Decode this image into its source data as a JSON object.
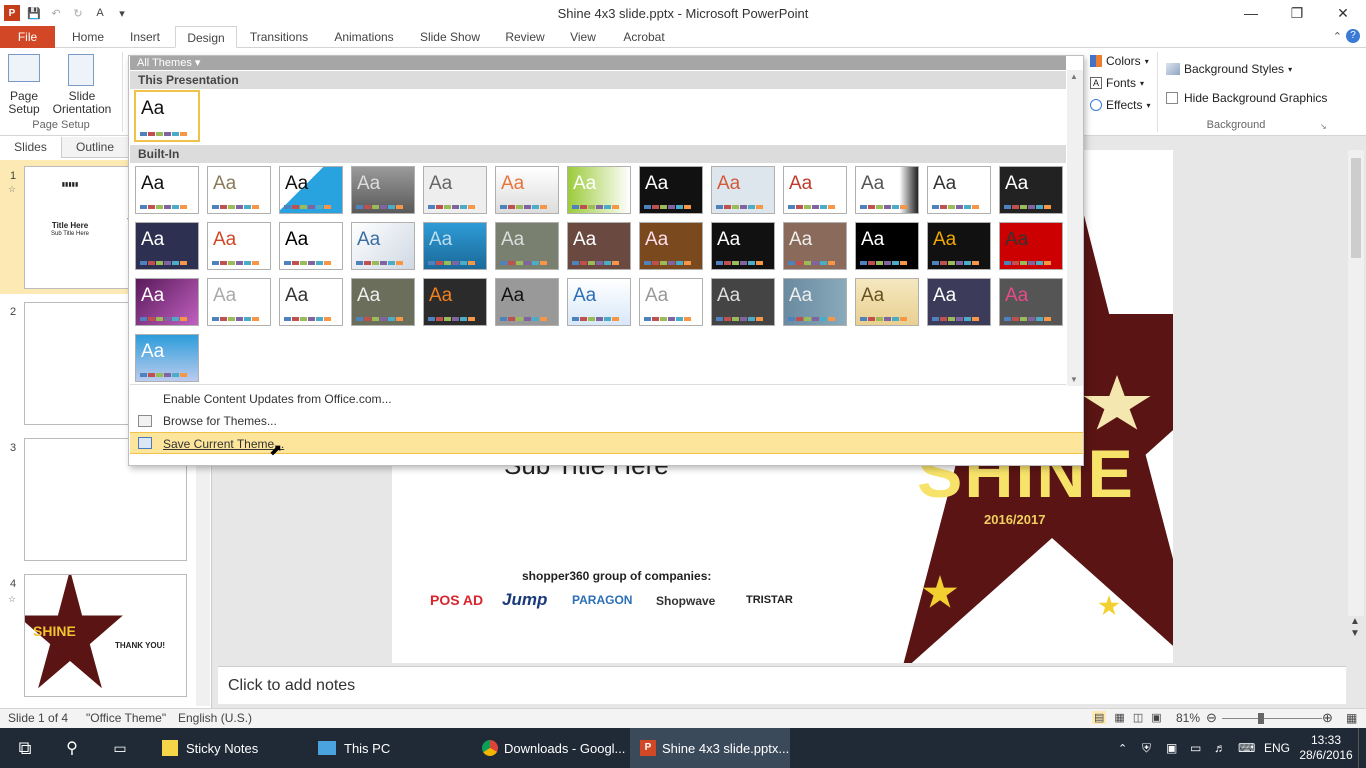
{
  "window": {
    "title": "Shine 4x3 slide.pptx - Microsoft PowerPoint"
  },
  "ribbon_tabs": [
    "File",
    "Home",
    "Insert",
    "Design",
    "Transitions",
    "Animations",
    "Slide Show",
    "Review",
    "View",
    "Acrobat"
  ],
  "ribbon": {
    "page_setup": {
      "page_setup_label": "Page\nSetup",
      "page_setup_l1": "Page",
      "page_setup_l2": "Setup",
      "orientation_l1": "Slide",
      "orientation_l2": "Orientation",
      "group_label": "Page Setup"
    },
    "theme_options": {
      "colors": "Colors",
      "fonts": "Fonts",
      "effects": "Effects"
    },
    "background": {
      "styles": "Background Styles",
      "hide_graphics": "Hide Background Graphics",
      "group_label": "Background"
    }
  },
  "gallery": {
    "filter_label": "All Themes",
    "section_this": "This Presentation",
    "section_builtin": "Built-In",
    "sample_text": "Aa",
    "menu": {
      "enable_updates": "Enable Content Updates from Office.com...",
      "browse": "Browse for Themes...",
      "save_current": "Save Current Theme..."
    }
  },
  "pane": {
    "tab_slides": "Slides",
    "tab_outline": "Outline",
    "slide_numbers": [
      "1",
      "2",
      "3",
      "4"
    ]
  },
  "thumb1": {
    "title": "Title Here",
    "subtitle": "Sub Title Here"
  },
  "thumb4": {
    "thanks": "THANK YOU!",
    "shine": "SHINE"
  },
  "slide": {
    "subtitle": "Sub Title Here",
    "group_text": "shopper360 group of companies:",
    "shine": "SHINE",
    "year": "2016/2017",
    "logos": [
      "POS AD",
      "Jump",
      "PARAGON",
      "Shopwave",
      "TRISTAR"
    ]
  },
  "notes": {
    "placeholder": "Click to add notes"
  },
  "status": {
    "slide": "Slide 1 of 4",
    "theme": "\"Office Theme\"",
    "language": "English (U.S.)",
    "zoom": "81%"
  },
  "taskbar": {
    "items": [
      "Sticky Notes",
      "This PC",
      "Downloads - Googl...",
      "Shine 4x3 slide.pptx..."
    ],
    "lang": "ENG",
    "time": "13:33",
    "date": "28/6/2016"
  },
  "colors": {
    "file_tab": "#d24726",
    "gallery_hover": "#fde59c",
    "taskbar": "#1f2a36",
    "slide_star": "#5a1414"
  }
}
